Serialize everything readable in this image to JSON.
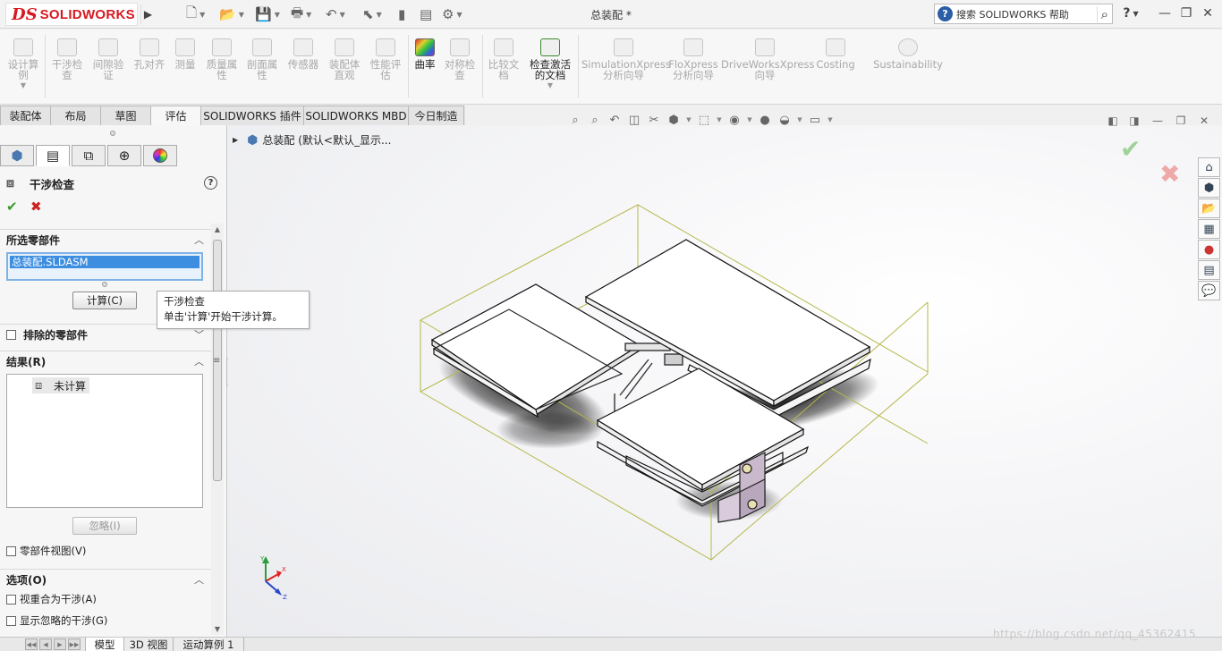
{
  "title_bar": {
    "logo_ds": "DS",
    "logo_text": "SOLIDWORKS",
    "document_title": "总装配 *",
    "search_placeholder": "搜索 SOLIDWORKS 帮助",
    "help_label": "?",
    "quick_access": [
      "new-icon",
      "open-icon",
      "save-icon",
      "print-icon",
      "undo-icon",
      "select-icon",
      "rebuild-icon",
      "file-properties-icon",
      "options-icon"
    ]
  },
  "command_manager": {
    "items": [
      {
        "label": "设计算\n例",
        "enabled": false
      },
      {
        "label": "干涉检\n查",
        "enabled": false
      },
      {
        "label": "间隙验\n证",
        "enabled": false
      },
      {
        "label": "孔对齐",
        "enabled": false
      },
      {
        "label": "测量",
        "enabled": false
      },
      {
        "label": "质量属\n性",
        "enabled": false
      },
      {
        "label": "剖面属\n性",
        "enabled": false
      },
      {
        "label": "传感器",
        "enabled": false
      },
      {
        "label": "装配体\n直观",
        "enabled": false
      },
      {
        "label": "性能评\n估",
        "enabled": false
      },
      {
        "label": "曲率",
        "enabled": true
      },
      {
        "label": "对称检\n查",
        "enabled": false
      },
      {
        "label": "比较文\n档",
        "enabled": false
      },
      {
        "label": "检查激活\n的文档",
        "enabled": true
      },
      {
        "label": "SimulationXpress\n分析向导",
        "enabled": false
      },
      {
        "label": "FloXpress\n分析向导",
        "enabled": false
      },
      {
        "label": "DriveWorksXpress\n向导",
        "enabled": false
      },
      {
        "label": "Costing",
        "enabled": false
      },
      {
        "label": "Sustainability",
        "enabled": false
      }
    ]
  },
  "cm_tabs": [
    "装配体",
    "布局",
    "草图",
    "评估",
    "SOLIDWORKS 插件",
    "SOLIDWORKS MBD",
    "今日制造"
  ],
  "cm_tab_selected": "评估",
  "property_manager": {
    "title": "干涉检查",
    "help": "?",
    "ok": "✔",
    "cancel": "✖",
    "selected_components": {
      "header": "所选零部件",
      "items": [
        "总装配.SLDASM"
      ],
      "calculate_button": "计算(C)"
    },
    "excluded_components": {
      "header": "排除的零部件",
      "checked": false
    },
    "results": {
      "header": "结果(R)",
      "items": [
        "未计算"
      ],
      "ignore_button": "忽略(I)",
      "component_view_label": "零部件视图(V)"
    },
    "options": {
      "header": "选项(O)",
      "items": [
        "视重合为干涉(A)",
        "显示忽略的干涉(G)"
      ]
    }
  },
  "tooltip": {
    "title": "干涉检查",
    "text": "单击'计算'开始干涉计算。"
  },
  "viewport": {
    "tree_root_label": "总装配  (默认<默认_显示..."
  },
  "bottom_tabs": [
    "模型",
    "3D 视图",
    "运动算例 1"
  ],
  "bottom_tab_selected": "模型",
  "watermark": "https://blog.csdn.net/qq_45362415",
  "colors": {
    "accent_red": "#d71920",
    "ok_green": "#3c9a2e",
    "selection_blue": "#3d8ee0",
    "bbox_yellow": "#b7b74a"
  }
}
